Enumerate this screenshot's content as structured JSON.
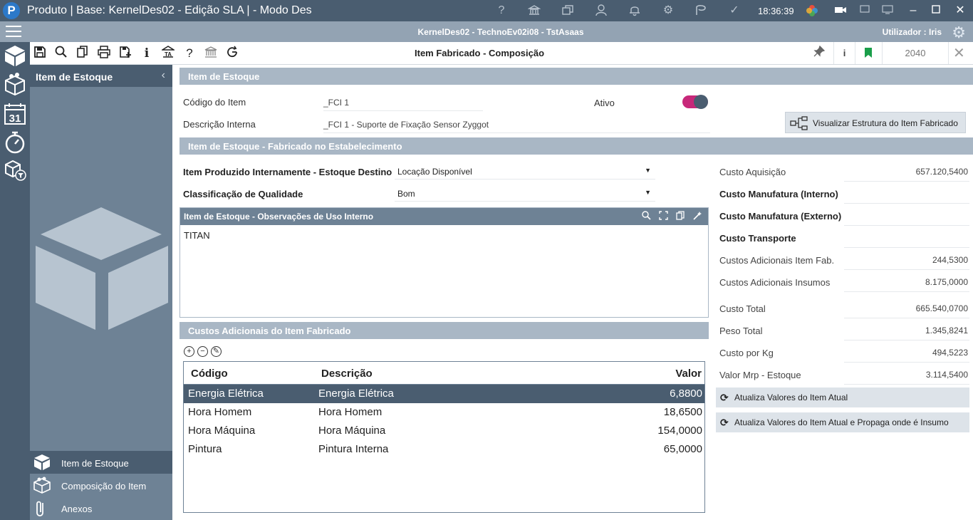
{
  "window": {
    "title": "Produto | Base: KernelDes02 - Edição SLA | - Modo Des",
    "clock": "18:36:39",
    "app_logo": "P"
  },
  "infobar": {
    "center": "KernelDes02 - TechnoEv02i08 - TstAsaas",
    "user": "Utilizador : Iris"
  },
  "toolbar": {
    "title": "Item Fabricado - Composição",
    "info_label": "i",
    "code": "2040"
  },
  "leftpanel": {
    "title": "Item de Estoque",
    "nav": [
      {
        "label": "Item de Estoque"
      },
      {
        "label": "Composição do Item"
      },
      {
        "label": "Anexos"
      }
    ]
  },
  "section1": {
    "title": "Item de Estoque",
    "code_label": "Código do Item",
    "code_value": "_FCI 1",
    "active_label": "Ativo",
    "desc_label": "Descrição Interna",
    "desc_value": "_FCI 1 - Suporte de Fixação Sensor Zyggot",
    "struct_button": "Visualizar Estrutura do Item Fabricado"
  },
  "section2": {
    "title": "Item de Estoque - Fabricado no Estabelecimento",
    "dest_label": "Item Produzido Internamente - Estoque Destino",
    "dest_value": "Locação Disponível",
    "quality_label": "Classificação de Qualidade",
    "quality_value": "Bom"
  },
  "memo": {
    "title": "Item de Estoque - Observações de Uso Interno",
    "text": "TITAN"
  },
  "costs": {
    "title": "Custos Adicionais do Item Fabricado",
    "columns": {
      "code": "Código",
      "desc": "Descrição",
      "value": "Valor"
    },
    "rows": [
      {
        "code": "Energia Elétrica",
        "desc": "Energia Elétrica",
        "value": "6,8800"
      },
      {
        "code": "Hora  Homem",
        "desc": "Hora  Homem",
        "value": "18,6500"
      },
      {
        "code": "Hora Máquina",
        "desc": "Hora Máquina",
        "value": "154,0000"
      },
      {
        "code": "Pintura",
        "desc": "Pintura Interna",
        "value": "65,0000"
      }
    ]
  },
  "summary": {
    "items": [
      {
        "label": "Custo Aquisição",
        "value": "657.120,5400"
      },
      {
        "label": "Custo Manufatura (Interno)",
        "value": ""
      },
      {
        "label": "Custo Manufatura (Externo)",
        "value": ""
      },
      {
        "label": "Custo Transporte",
        "value": ""
      },
      {
        "label": "Custos Adicionais Item Fab.",
        "value": "244,5300"
      },
      {
        "label": "Custos Adicionais Insumos",
        "value": "8.175,0000"
      },
      {
        "label": "Custo Total",
        "value": "665.540,0700"
      },
      {
        "label": "Peso Total",
        "value": "1.345,8241"
      },
      {
        "label": "Custo por Kg",
        "value": "494,5223"
      },
      {
        "label": "Valor Mrp - Estoque",
        "value": "3.114,5400"
      }
    ],
    "btn_update": "Atualiza Valores do Item Atual",
    "btn_update_propagate": "Atualiza Valores do Item Atual e Propaga onde é Insumo"
  },
  "colors": {
    "dark": "#4a5d70",
    "mid": "#6e8295",
    "light": "#a9b7c5",
    "toggle": "#c7287a"
  }
}
